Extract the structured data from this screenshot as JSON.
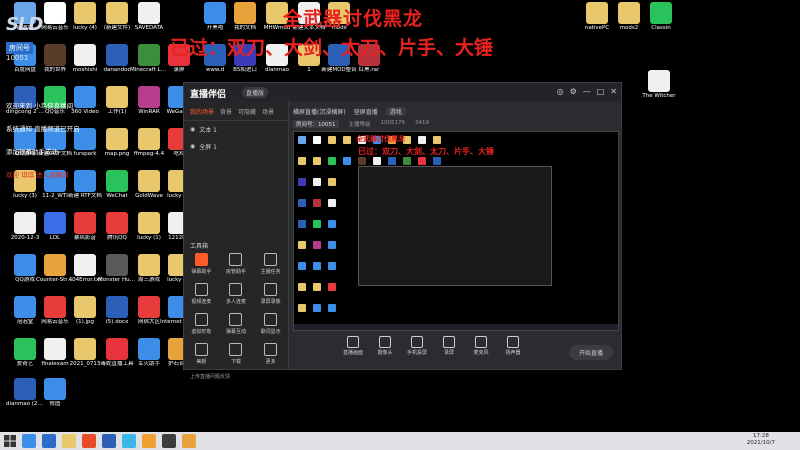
{
  "overlay": {
    "title": "全武器讨伐黑龙",
    "subtitle": "已过：双刀、大剑、太刀、片手、大锤"
  },
  "stream": {
    "logo": "SLD",
    "room_label": "房间号",
    "room_number": "10051"
  },
  "chat": [
    {
      "text": "欢迎来到 小鸟侠直播间"
    },
    {
      "text": "系统通知 直播频道已开启"
    },
    {
      "text": "添加弹幕助手成功"
    },
    {
      "text": "欢迎 琪琪 进入直播间"
    }
  ],
  "desktop_icons": [
    {
      "label": "回收站",
      "color": "#6aa7e8"
    },
    {
      "label": "网易云音乐",
      "color": "#ffffff"
    },
    {
      "label": "lucky (4)",
      "color": "#e8c86a"
    },
    {
      "label": "(新建文件)",
      "color": "#e8c86a"
    },
    {
      "label": "SAVEDATA",
      "color": "#f0f0f0"
    },
    {
      "label": "开黑啦",
      "color": "#3c8ee8"
    },
    {
      "label": "我的文档",
      "color": "#e8a23c"
    },
    {
      "label": "MHWmod",
      "color": "#e8c86a"
    },
    {
      "label": "新建文本文档",
      "color": "#f0f0f0"
    },
    {
      "label": "mods",
      "color": "#e8c86a"
    },
    {
      "label": "nativePC",
      "color": "#e8c86a"
    },
    {
      "label": "mods2",
      "color": "#e8c86a"
    },
    {
      "label": "Classin",
      "color": "#2ac25a"
    },
    {
      "label": "百度网盘",
      "color": "#3c8ee8"
    },
    {
      "label": "我的世界",
      "color": "#5a3c2a"
    },
    {
      "label": "moshishi",
      "color": "#f0f0f0"
    },
    {
      "label": "danandoc",
      "color": "#2b5fb8"
    },
    {
      "label": "Minecraft Launcher",
      "color": "#3c8e3c"
    },
    {
      "label": "录屏",
      "color": "#e8323c"
    },
    {
      "label": "www.d",
      "color": "#2b5fb8"
    },
    {
      "label": "B5和进口",
      "color": "#3c3cb8"
    },
    {
      "label": "dianmao",
      "color": "#f0f0f0"
    },
    {
      "label": "1",
      "color": "#e8c86a"
    },
    {
      "label": "新建MOD整合",
      "color": "#2b5fb8"
    },
    {
      "label": "红黑.rar",
      "color": "#b8323c"
    },
    {
      "label": "The Witcher",
      "color": "#f0f0f0"
    },
    {
      "label": "dingcong 2 sanyanbotong",
      "color": "#2b5fb8"
    },
    {
      "label": "QQ音乐",
      "color": "#2ac25a"
    },
    {
      "label": "360 Video",
      "color": "#3c8ee8"
    },
    {
      "label": "工作(1)",
      "color": "#e8c86a"
    },
    {
      "label": "WinRAR",
      "color": "#b83c8e"
    },
    {
      "label": "WeGame",
      "color": "#3c8ee8"
    },
    {
      "label": "QQ游戏",
      "color": "#3c8ee8"
    },
    {
      "label": "新建 RTF文档",
      "color": "#3c8ee8"
    },
    {
      "label": "furspark",
      "color": "#3c8ee8"
    },
    {
      "label": "map.png",
      "color": "#e8c86a"
    },
    {
      "label": "ffmpeg-4.4",
      "color": "#e8c86a"
    },
    {
      "label": "吃鸡",
      "color": "#e83c3c"
    },
    {
      "label": "lucky (3)",
      "color": "#e8c86a"
    },
    {
      "label": "11-2_WTI",
      "color": "#3c8ee8"
    },
    {
      "label": "新建 RTF文档",
      "color": "#3c8ee8"
    },
    {
      "label": "WeChat",
      "color": "#2ac25a"
    },
    {
      "label": "GoldWave",
      "color": "#e8c86a"
    },
    {
      "label": "lucky (2)",
      "color": "#e8c86a"
    },
    {
      "label": "2020-12-3",
      "color": "#f0f0f0"
    },
    {
      "label": "LOL",
      "color": "#3c6ee8"
    },
    {
      "label": "暴风影音",
      "color": "#e83c3c"
    },
    {
      "label": "腾讯QQ",
      "color": "#e83c3c"
    },
    {
      "label": "lucky (1)",
      "color": "#e8c86a"
    },
    {
      "label": "1212LiJi",
      "color": "#f0f0f0"
    },
    {
      "label": "QQ游戏",
      "color": "#3c8ee8"
    },
    {
      "label": "Counter-Strike Global Off",
      "color": "#e8a23c"
    },
    {
      "label": "404Error.txt",
      "color": "#f0f0f0"
    },
    {
      "label": "Monster Hunter",
      "color": "#5a5a5a"
    },
    {
      "label": "周三游戏",
      "color": "#e8c86a"
    },
    {
      "label": "lucky (5)",
      "color": "#e8c86a"
    },
    {
      "label": "泡泡堂",
      "color": "#3c8ee8"
    },
    {
      "label": "网易云音乐",
      "color": "#e83c3c"
    },
    {
      "label": "(1).jpg",
      "color": "#e8c86a"
    },
    {
      "label": "(5).docx",
      "color": "#2b5fb8"
    },
    {
      "label": "网宿大区",
      "color": "#e83c3c"
    },
    {
      "label": "Internet Explorer",
      "color": "#3c8ee8"
    },
    {
      "label": "爱奇艺",
      "color": "#2ac25a"
    },
    {
      "label": "finalexam",
      "color": "#f0f0f0"
    },
    {
      "label": "2021_0713",
      "color": "#e8c86a"
    },
    {
      "label": "毒蛇直播工具",
      "color": "#e8323c"
    },
    {
      "label": "军火助手",
      "color": "#3c8ee8"
    },
    {
      "label": "护石合集",
      "color": "#e8a23c"
    },
    {
      "label": "dianmao (2).docx",
      "color": "#2b5fb8"
    },
    {
      "label": "修图",
      "color": "#3c8ee8"
    }
  ],
  "app": {
    "logo": "直播伴侣",
    "badge": "直播版",
    "window_buttons": [
      "◎",
      "⚙",
      "—",
      "□",
      "✕"
    ],
    "left_tabs": [
      "我的场景",
      "背景",
      "可隐藏",
      "场景"
    ],
    "scenes": [
      "文本 1",
      "全屏 1"
    ],
    "tools_title": "工具箱",
    "tools": [
      "弹幕助手",
      "房管助手",
      "主播任务",
      "视频连麦",
      "多人连麦",
      "录屏录像",
      "虚拟形象",
      "弹幕互动",
      "歌词显示",
      "美颜",
      "下载",
      "更多"
    ],
    "bottom_link": "上传直播问题反馈",
    "main_tabs": [
      "横屏直播(沉浸横屏)",
      "竖屏直播",
      "游戏"
    ],
    "info": [
      "房间号：10051",
      "主播等级",
      "1005176",
      "3419"
    ],
    "controls": [
      "直播画面",
      "摄像头",
      "手机投屏",
      "录屏",
      "麦克风",
      "扬声器"
    ],
    "start_button": "开始直播"
  },
  "taskbar": {
    "time": "17:28",
    "date": "2021/10/7"
  }
}
